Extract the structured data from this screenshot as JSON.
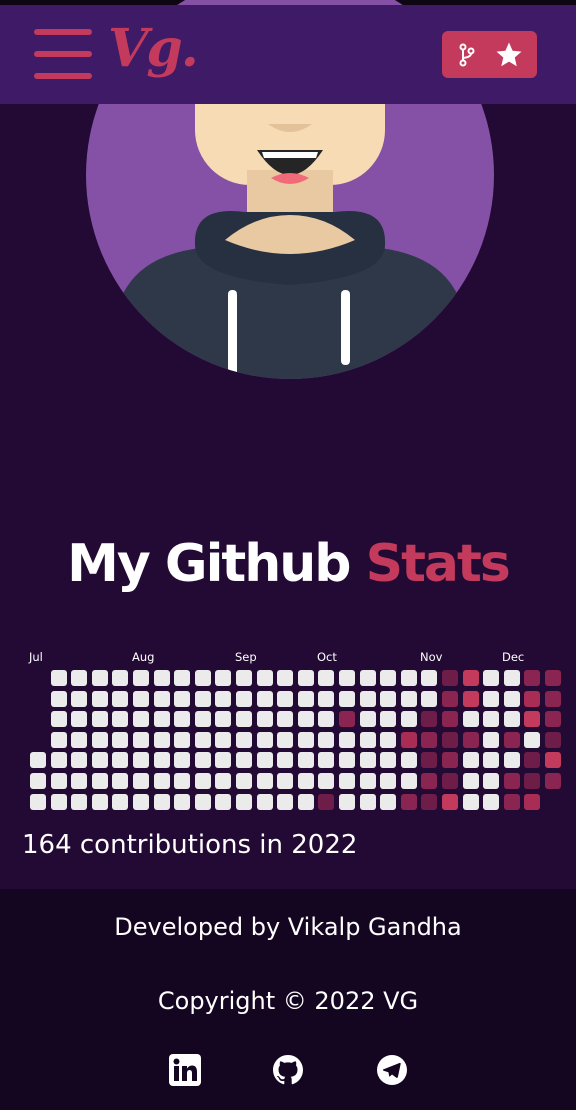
{
  "navbar": {
    "logo": "Vg.",
    "menu_icon": "hamburger-menu-icon",
    "repo_icons": [
      "git-fork-icon",
      "star-icon"
    ]
  },
  "stats": {
    "title_main": "My Github",
    "title_accent": "Stats",
    "months": [
      "Jul",
      "Aug",
      "Sep",
      "Oct",
      "Nov",
      "Dec"
    ],
    "contributions_text": "164 contributions in 2022"
  },
  "footer": {
    "developed_by": "Developed by Vikalp Gandha",
    "copyright": "Copyright © 2022 VG",
    "social_icons": [
      "linkedin-icon",
      "github-icon",
      "telegram-icon"
    ]
  },
  "colors": {
    "background": "#230a34",
    "navbar": "#3f1a67",
    "footer": "#140521",
    "accent": "#c33a5c",
    "avatar_circle": "#8551a7",
    "contribution_levels": [
      "#ebebeb",
      "#6e1d48",
      "#8a2450",
      "#a92c55",
      "#c33a5c"
    ]
  }
}
